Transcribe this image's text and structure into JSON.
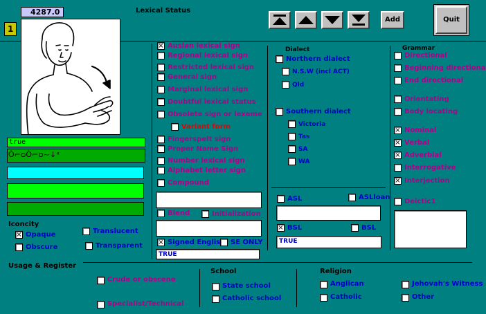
{
  "header": {
    "record_number": "4287.0",
    "record_index": "1",
    "title": "Lexical Status",
    "add_label": "Add",
    "quit_label": "Quit"
  },
  "left_fields": {
    "field1": "true",
    "notation": "Ò⌐ᴑÒ⌐ᴑ~↓ˣ",
    "colors": {
      "cyan": "#00ffff",
      "bright_green": "#00ff00",
      "dark_green": "#00aa00"
    }
  },
  "iconicity": {
    "heading": "Iconcity",
    "opaque": "Opaque",
    "obscure": "Obscure",
    "translucent": "Translucent",
    "transparent": "Transparent"
  },
  "lexical_status": {
    "auslan": "Auslan lexical sign",
    "regional": "Regional lexical sign",
    "restricted": "Restricted lexical sign",
    "general": "General sign",
    "marginal": "Marginal lexical sign",
    "doubtful": "Doubtful lexical status",
    "obsolete": "Obsolete sign or lexeme",
    "variant": "Variant form",
    "fingerspelt": "Fingerspelt sign",
    "proper_name": "Proper Name Sign",
    "number": "Number lexical sign",
    "alphabet": "Alphabet letter sign",
    "compound": "Compound",
    "blend": "Blend",
    "initialization": "Initialization",
    "signed_english": "Signed English",
    "se_only": "SE ONLY",
    "signed_english_value": "TRUE"
  },
  "dialect": {
    "heading": "Dialect",
    "northern": "Northern dialect",
    "nsw": "N.S.W (incl ACT)",
    "qld": "Qld",
    "southern": "Southern dialect",
    "victoria": "Victoria",
    "tas": "Tas",
    "sa": "SA",
    "wa": "WA",
    "asl": "ASL",
    "asl_loan": "ASLloan",
    "bsl_left": "BSL",
    "bsl_right": "BSL",
    "bsl_value": "TRUE"
  },
  "grammar": {
    "heading": "Grammar",
    "directional": "Directional",
    "beginning_directional": "Beginning directional",
    "end_directional": "End directional",
    "orientating": "Orientating",
    "body_locating": "Body locating",
    "nominal": "Nominal",
    "verbal": "Verbal",
    "adverbial": "Adverbial",
    "interrogative": "Interrogative",
    "interjection": "Interjection",
    "deictic": "Deictic1"
  },
  "usage": {
    "heading": "Usage & Register",
    "crude": "Crude or obscene",
    "specialist": "Specialist/Technical"
  },
  "school": {
    "heading": "School",
    "state": "State school",
    "catholic": "Catholic school"
  },
  "religion": {
    "heading": "Religion",
    "anglican": "Anglican",
    "catholic": "Catholic",
    "jehovah": "Jehovah's Witness",
    "other": "Other"
  }
}
